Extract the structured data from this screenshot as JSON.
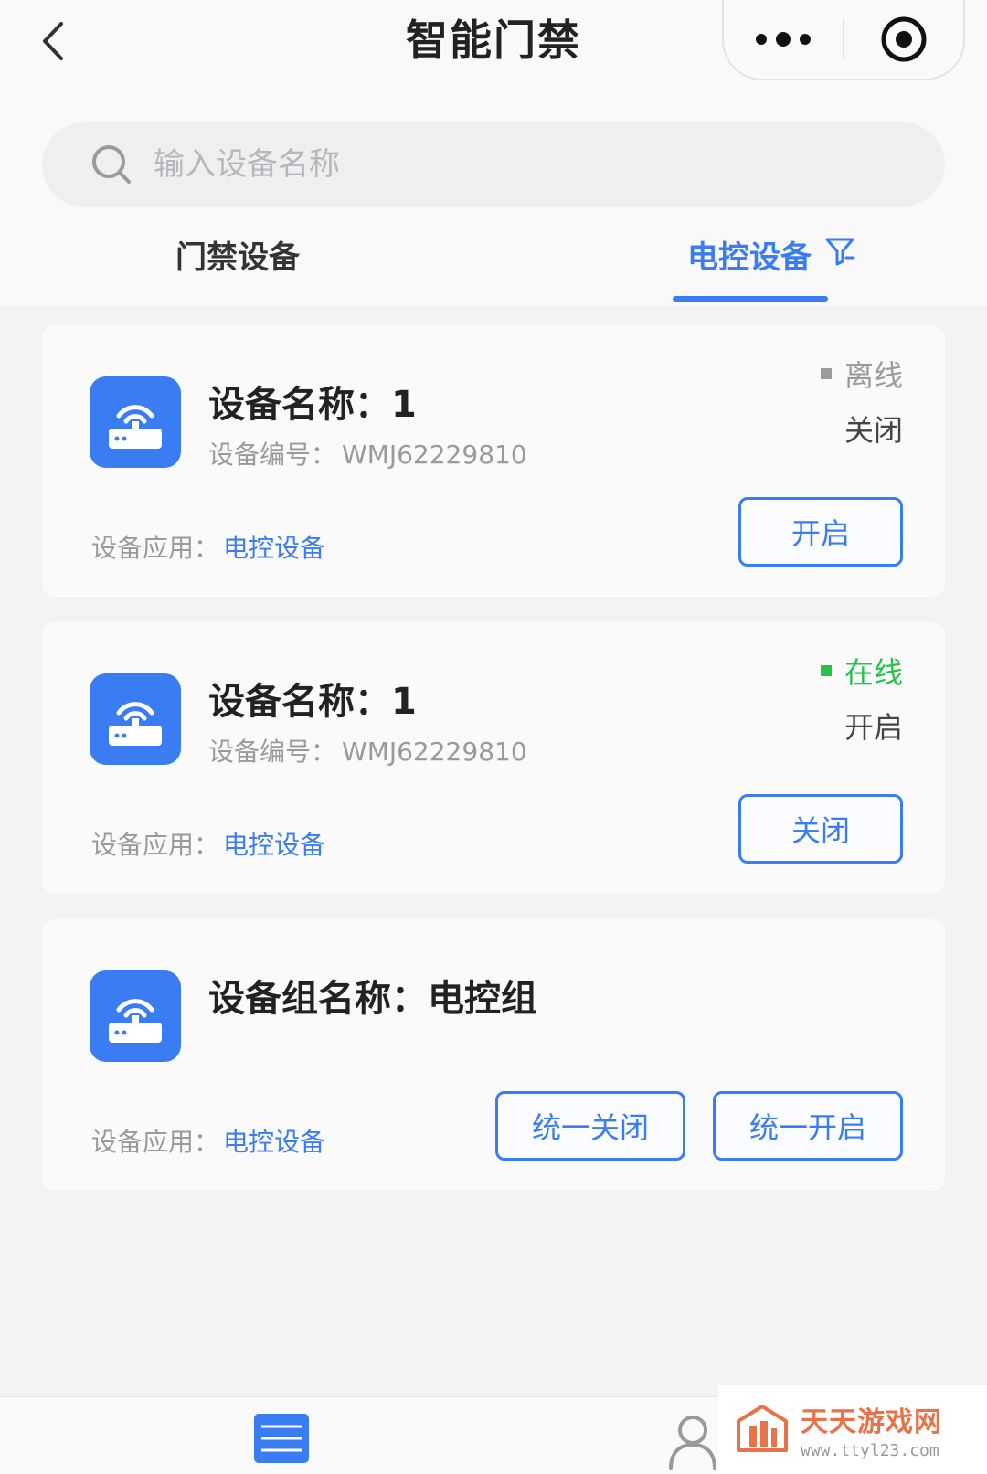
{
  "header": {
    "title": "智能门禁",
    "back_icon": "chevron-left-icon",
    "more_icon": "more-dots-icon",
    "close_icon": "target-circle-icon"
  },
  "search": {
    "placeholder": "输入设备名称",
    "value": ""
  },
  "tabs": [
    {
      "label": "门禁设备",
      "active": false
    },
    {
      "label": "电控设备",
      "active": true,
      "icon": "filter-icon"
    }
  ],
  "devices": [
    {
      "name_label": "设备名称：",
      "name": "1",
      "code_label": "设备编号：",
      "code": "WMJ62229810",
      "status": "离线",
      "status_color": "#9b9b9b",
      "switch_state": "关闭",
      "app_label": "设备应用：",
      "app": "电控设备",
      "button_label": "开启"
    },
    {
      "name_label": "设备名称：",
      "name": "1",
      "code_label": "设备编号：",
      "code": "WMJ62229810",
      "status": "在线",
      "status_color": "#27c24c",
      "switch_state": "开启",
      "app_label": "设备应用：",
      "app": "电控设备",
      "button_label": "关闭"
    }
  ],
  "group": {
    "name_label": "设备组名称：",
    "name": "电控组",
    "app_label": "设备应用：",
    "app": "电控设备",
    "close_all_label": "统一关闭",
    "open_all_label": "统一开启"
  },
  "bottom_nav": [
    {
      "icon": "list-icon",
      "active": true
    },
    {
      "icon": "user-icon",
      "active": false
    }
  ],
  "watermark": {
    "title": "天天游戏网",
    "url": "www.ttyl23.com"
  },
  "colors": {
    "accent": "#3a7cf2",
    "online": "#27c24c",
    "offline": "#9b9b9b",
    "watermark": "#e8734a"
  }
}
